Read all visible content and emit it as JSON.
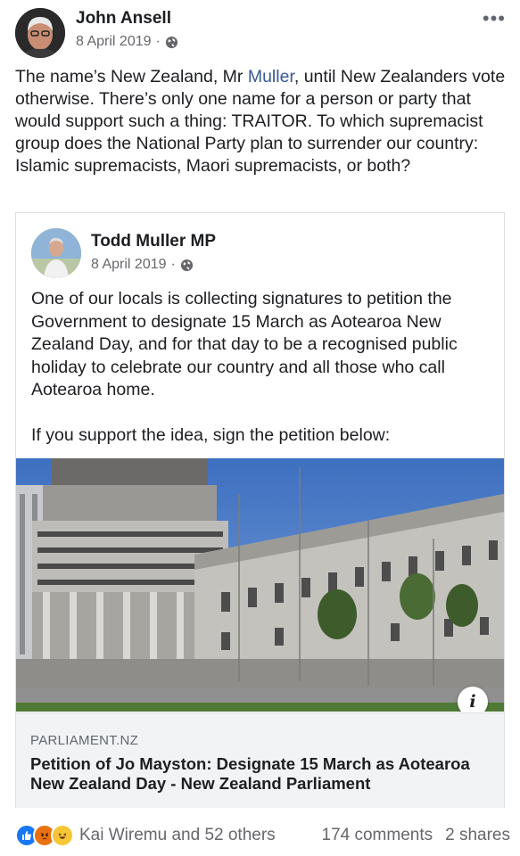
{
  "post": {
    "author": "John Ansell",
    "date": "8 April 2019",
    "more_icon": "more-horizontal-icon",
    "privacy_icon": "globe-icon",
    "text_before_link": "The name’s New Zealand, Mr ",
    "text_link": "Muller",
    "text_after_link": ", until New Zealanders vote otherwise. There’s only one name for a person or party that would support such a thing: TRAITOR. To which supremacist group does the National Party plan to surrender our country: Islamic supremacists, Maori supremacists, or both?"
  },
  "shared_post": {
    "author": "Todd Muller MP",
    "date": "8 April 2019",
    "paragraph1": "One of our locals is collecting signatures to petition the Government to designate 15 March as Aotearoa New Zealand Day, and for that day to be a recognised public holiday to celebrate our country and all those who call Aotearoa home.",
    "paragraph2": "If you support the idea, sign the petition below:",
    "info_icon_label": "i"
  },
  "link_preview": {
    "domain": "PARLIAMENT.NZ",
    "title": "Petition of Jo Mayston: Designate 15 March as Aotearoa New Zealand Day - New Zealand Parliament"
  },
  "footer": {
    "reactions": [
      "like-icon",
      "angry-icon",
      "haha-icon"
    ],
    "reactors": "Kai Wiremu and 52 others",
    "comments": "174 comments",
    "shares": "2 shares"
  },
  "colors": {
    "link": "#385898",
    "like": "#1877f2",
    "angry": "#e9710f",
    "haha": "#f7c637",
    "meta": "#65676b"
  }
}
